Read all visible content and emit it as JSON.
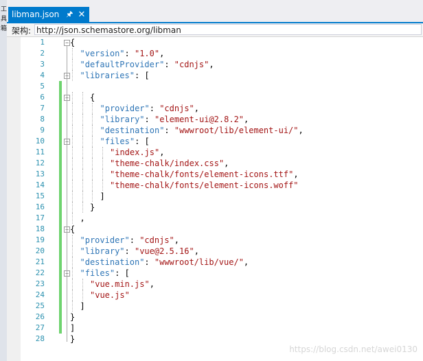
{
  "left_strip": {
    "glyphs": [
      "工",
      "具",
      "箱"
    ]
  },
  "tab": {
    "title": "libman.json",
    "pin_icon": "pin-icon",
    "close_icon": "close-icon"
  },
  "schema": {
    "label": "架构:",
    "value": "http://json.schemastore.org/libman"
  },
  "code": {
    "lines": [
      {
        "n": "1",
        "indent": 0,
        "tokens": [
          {
            "t": "p",
            "v": "{"
          }
        ]
      },
      {
        "n": "2",
        "indent": 1,
        "tokens": [
          {
            "t": "k",
            "v": "\"version\""
          },
          {
            "t": "p",
            "v": ": "
          },
          {
            "t": "s",
            "v": "\"1.0\""
          },
          {
            "t": "p",
            "v": ","
          }
        ]
      },
      {
        "n": "3",
        "indent": 1,
        "tokens": [
          {
            "t": "k",
            "v": "\"defaultProvider\""
          },
          {
            "t": "p",
            "v": ": "
          },
          {
            "t": "s",
            "v": "\"cdnjs\""
          },
          {
            "t": "p",
            "v": ","
          }
        ]
      },
      {
        "n": "4",
        "indent": 1,
        "tokens": [
          {
            "t": "k",
            "v": "\"libraries\""
          },
          {
            "t": "p",
            "v": ": ["
          }
        ]
      },
      {
        "n": "5",
        "indent": 0,
        "tokens": []
      },
      {
        "n": "6",
        "indent": 2,
        "tokens": [
          {
            "t": "p",
            "v": "{"
          }
        ]
      },
      {
        "n": "7",
        "indent": 3,
        "tokens": [
          {
            "t": "k",
            "v": "\"provider\""
          },
          {
            "t": "p",
            "v": ": "
          },
          {
            "t": "s",
            "v": "\"cdnjs\""
          },
          {
            "t": "p",
            "v": ","
          }
        ]
      },
      {
        "n": "8",
        "indent": 3,
        "tokens": [
          {
            "t": "k",
            "v": "\"library\""
          },
          {
            "t": "p",
            "v": ": "
          },
          {
            "t": "s",
            "v": "\"element-ui@2.8.2\""
          },
          {
            "t": "p",
            "v": ","
          }
        ]
      },
      {
        "n": "9",
        "indent": 3,
        "tokens": [
          {
            "t": "k",
            "v": "\"destination\""
          },
          {
            "t": "p",
            "v": ": "
          },
          {
            "t": "s",
            "v": "\"wwwroot/lib/element-ui/\""
          },
          {
            "t": "p",
            "v": ","
          }
        ]
      },
      {
        "n": "10",
        "indent": 3,
        "tokens": [
          {
            "t": "k",
            "v": "\"files\""
          },
          {
            "t": "p",
            "v": ": ["
          }
        ]
      },
      {
        "n": "11",
        "indent": 4,
        "tokens": [
          {
            "t": "s",
            "v": "\"index.js\""
          },
          {
            "t": "p",
            "v": ","
          }
        ]
      },
      {
        "n": "12",
        "indent": 4,
        "tokens": [
          {
            "t": "s",
            "v": "\"theme-chalk/index.css\""
          },
          {
            "t": "p",
            "v": ","
          }
        ]
      },
      {
        "n": "13",
        "indent": 4,
        "tokens": [
          {
            "t": "s",
            "v": "\"theme-chalk/fonts/element-icons.ttf\""
          },
          {
            "t": "p",
            "v": ","
          }
        ]
      },
      {
        "n": "14",
        "indent": 4,
        "tokens": [
          {
            "t": "s",
            "v": "\"theme-chalk/fonts/element-icons.woff\""
          }
        ]
      },
      {
        "n": "15",
        "indent": 3,
        "tokens": [
          {
            "t": "p",
            "v": "]"
          }
        ]
      },
      {
        "n": "16",
        "indent": 2,
        "tokens": [
          {
            "t": "p",
            "v": "}"
          }
        ]
      },
      {
        "n": "17",
        "indent": 1,
        "tokens": [
          {
            "t": "p",
            "v": ","
          }
        ]
      },
      {
        "n": "18",
        "indent": 0,
        "tokens": [
          {
            "t": "p",
            "v": "{"
          }
        ]
      },
      {
        "n": "19",
        "indent": 1,
        "tokens": [
          {
            "t": "k",
            "v": "\"provider\""
          },
          {
            "t": "p",
            "v": ": "
          },
          {
            "t": "s",
            "v": "\"cdnjs\""
          },
          {
            "t": "p",
            "v": ","
          }
        ]
      },
      {
        "n": "20",
        "indent": 1,
        "tokens": [
          {
            "t": "k",
            "v": "\"library\""
          },
          {
            "t": "p",
            "v": ": "
          },
          {
            "t": "s",
            "v": "\"vue@2.5.16\""
          },
          {
            "t": "p",
            "v": ","
          }
        ]
      },
      {
        "n": "21",
        "indent": 1,
        "tokens": [
          {
            "t": "k",
            "v": "\"destination\""
          },
          {
            "t": "p",
            "v": ": "
          },
          {
            "t": "s",
            "v": "\"wwwroot/lib/vue/\""
          },
          {
            "t": "p",
            "v": ","
          }
        ]
      },
      {
        "n": "22",
        "indent": 1,
        "tokens": [
          {
            "t": "k",
            "v": "\"files\""
          },
          {
            "t": "p",
            "v": ": ["
          }
        ]
      },
      {
        "n": "23",
        "indent": 2,
        "tokens": [
          {
            "t": "s",
            "v": "\"vue.min.js\""
          },
          {
            "t": "p",
            "v": ","
          }
        ]
      },
      {
        "n": "24",
        "indent": 2,
        "tokens": [
          {
            "t": "s",
            "v": "\"vue.js\""
          }
        ]
      },
      {
        "n": "25",
        "indent": 1,
        "tokens": [
          {
            "t": "p",
            "v": "]"
          }
        ]
      },
      {
        "n": "26",
        "indent": 0,
        "tokens": [
          {
            "t": "p",
            "v": "}"
          }
        ]
      },
      {
        "n": "27",
        "indent": 0,
        "tokens": [
          {
            "t": "p",
            "v": "]"
          }
        ]
      },
      {
        "n": "28",
        "indent": 0,
        "tokens": [
          {
            "t": "p",
            "v": "}"
          }
        ]
      }
    ],
    "changed_lines": [
      "5",
      "6",
      "7",
      "8",
      "9",
      "10",
      "11",
      "12",
      "13",
      "14",
      "15",
      "16",
      "17",
      "18",
      "19",
      "20",
      "21",
      "22",
      "23",
      "24",
      "25",
      "26",
      "27"
    ],
    "fold_lines": [
      "1",
      "4",
      "6",
      "10",
      "18",
      "22"
    ]
  },
  "watermark": "https://blog.csdn.net/awei0130",
  "colors": {
    "accent": "#007acc",
    "key": "#2e75b6",
    "string": "#a31515",
    "line_number": "#2b91af",
    "change": "#6ed36e"
  }
}
